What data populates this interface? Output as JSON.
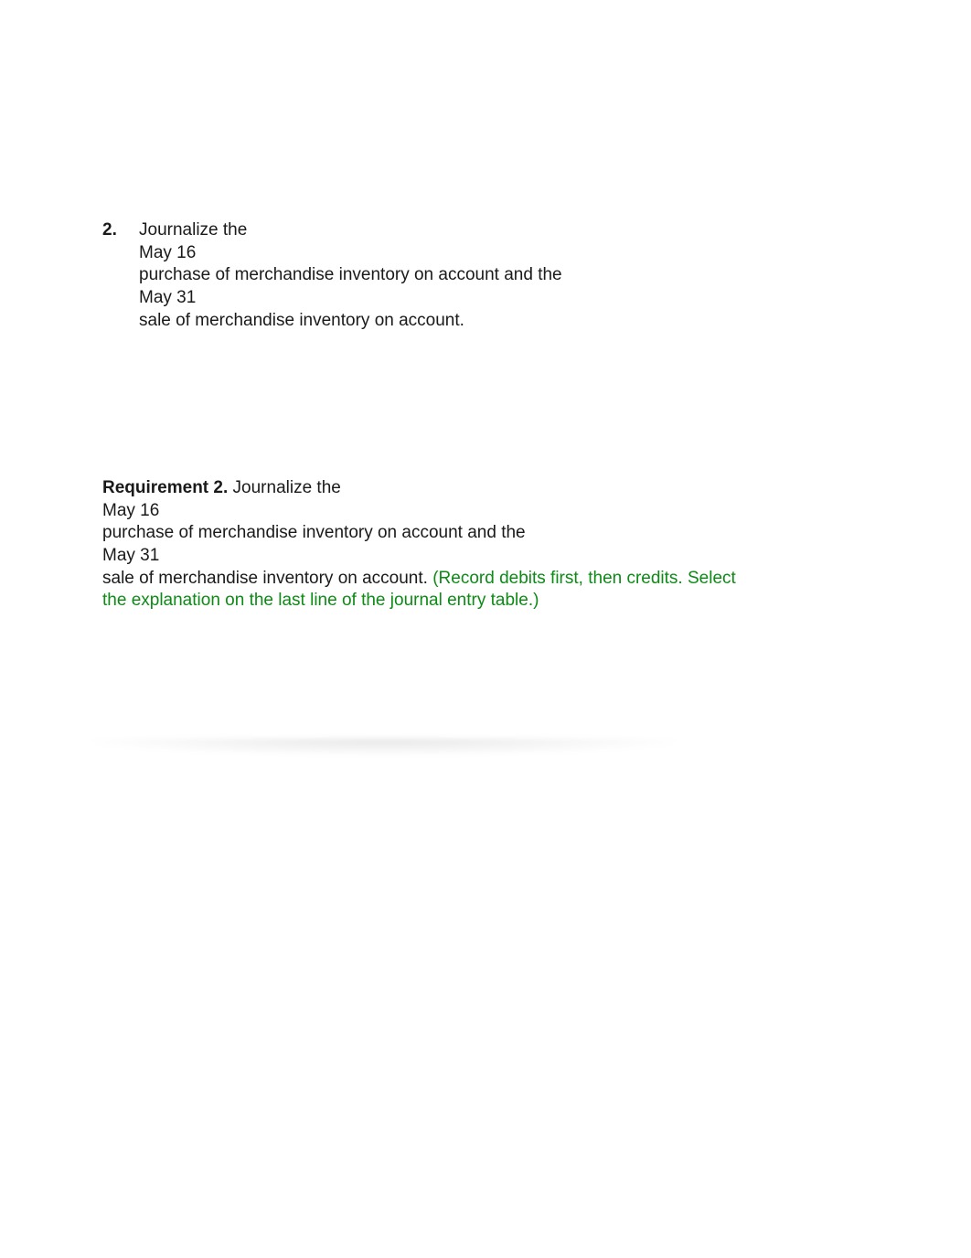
{
  "section1": {
    "number": "2.",
    "line1": "Journalize the",
    "line2": "May 16",
    "line3": "purchase of merchandise inventory on account and the",
    "line4": "May 31",
    "line5": "sale of merchandise inventory on account."
  },
  "section2": {
    "req_label": "Requirement 2.",
    "line1": " Journalize the",
    "line2": "May 16",
    "line3": "purchase of merchandise inventory on account and the",
    "line4": "May 31",
    "line5": "sale of merchandise inventory on account. ",
    "instruction": "(Record debits first, then credits. Select the explanation on the last line of the journal entry table.)"
  },
  "colors": {
    "instruction_green": "#0e8a16"
  }
}
